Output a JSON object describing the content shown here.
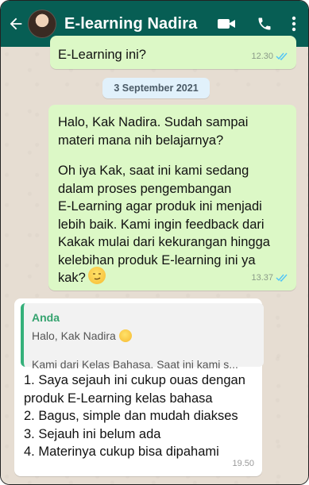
{
  "header": {
    "title": "E-learning Nadira",
    "back_icon": "arrow-left-icon",
    "video_icon": "video-call-icon",
    "call_icon": "phone-icon",
    "more_icon": "more-vertical-icon",
    "bg_color": "#075e54"
  },
  "messages": {
    "top": {
      "text": "E-Learning ini?",
      "time": "12.30"
    },
    "date_chip": "3 September 2021",
    "main": {
      "para1": "Halo, Kak Nadira. Sudah sampai\nmateri mana nih belajarnya?",
      "para2": "Oh iya Kak, saat ini kami sedang\ndalam proses pengembangan\nE-Learning agar produk ini menjadi\nlebih baik. Kami ingin feedback dari\nKakak mulai dari kekurangan hingga\nkelebihan produk E-learning ini ya\nkak?",
      "time": "13.37"
    },
    "reply": {
      "quote_name": "Anda",
      "quote_line1": "Halo, Kak Nadira",
      "quote_line2": "Kami dari Kelas Bahasa. Saat ini kami s...",
      "body": "1. Saya sejauh ini cukup ouas dengan\nproduk E-Learning kelas bahasa\n2. Bagus, simple dan mudah diakses\n3. Sejauh ini belum ada\n4. Materinya cukup bisa dipahami",
      "time": "19.50"
    }
  },
  "colors": {
    "outgoing": "#dcf8c6",
    "incoming": "#ffffff",
    "read_tick": "#4fc3f7",
    "quote_accent": "#35b07a"
  }
}
